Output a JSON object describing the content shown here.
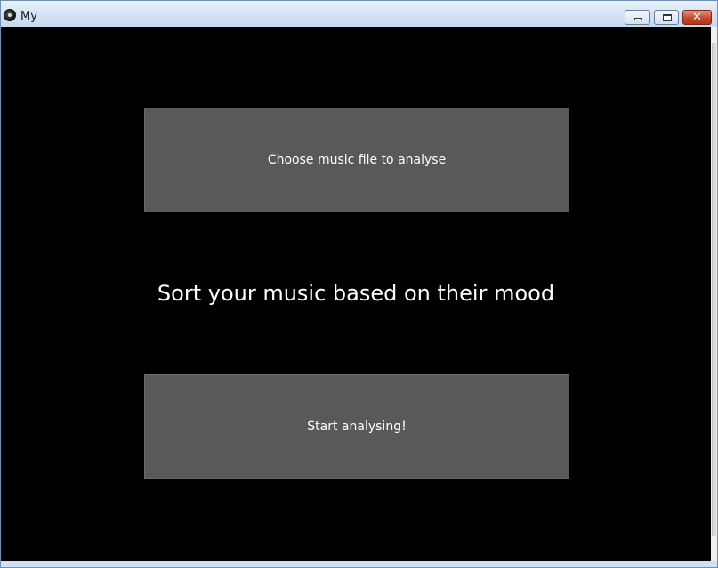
{
  "window": {
    "title": "My",
    "minimize_label": "",
    "maximize_label": "",
    "close_label": "✕"
  },
  "main": {
    "choose_button_label": "Choose music file to analyse",
    "headline": "Sort your music based on their mood",
    "start_button_label": "Start analysing!"
  },
  "colors": {
    "background": "#000000",
    "button_fill": "#595959",
    "text": "#ffffff",
    "close_button": "#c9492f"
  }
}
